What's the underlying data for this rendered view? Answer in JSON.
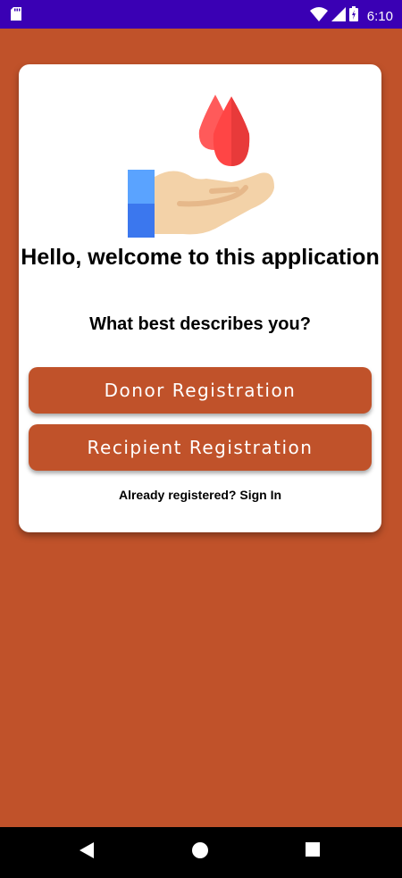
{
  "status_bar": {
    "time": "6:10",
    "icons": [
      "sd-card-icon",
      "wifi-icon",
      "signal-icon",
      "battery-icon"
    ]
  },
  "card": {
    "title": "Hello, welcome to this application",
    "question": "What best describes you?",
    "donor_button": "Donor Registration",
    "recipient_button": "Recipient Registration",
    "signin_link": "Already registered? Sign In"
  },
  "colors": {
    "background": "#c0522a",
    "status_bar": "#3a00b4",
    "button": "#c0522a",
    "drop": "#ff4b4b"
  },
  "nav_bar": {
    "icons": [
      "back-icon",
      "home-icon",
      "recents-icon"
    ]
  }
}
